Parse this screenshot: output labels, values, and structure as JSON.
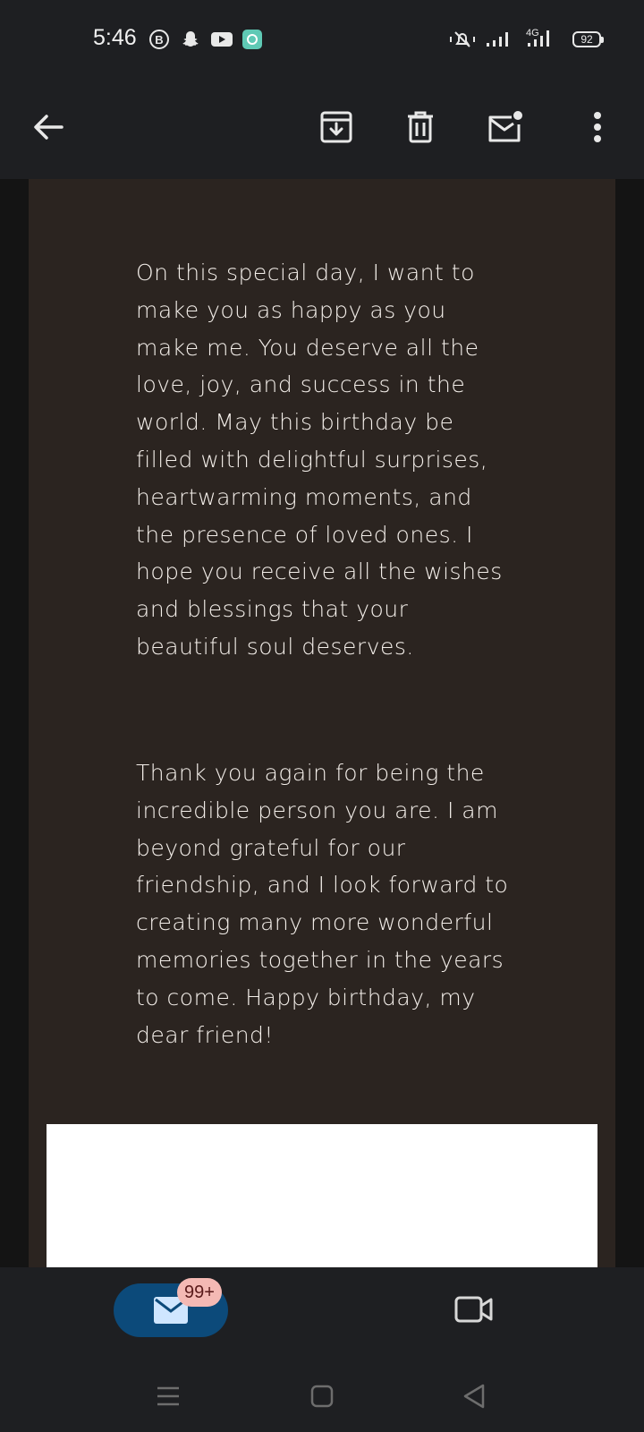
{
  "status_bar": {
    "time": "5:46",
    "battery": "92",
    "network": "4G",
    "icons": [
      "b-circle-icon",
      "snapchat-icon",
      "youtube-icon",
      "app-icon",
      "mute-icon",
      "signal-icon",
      "signal-4g-icon",
      "battery-icon"
    ]
  },
  "toolbar": {
    "icons": [
      "back-arrow-icon",
      "archive-icon",
      "delete-icon",
      "mark-unread-icon",
      "more-options-icon"
    ]
  },
  "email": {
    "paragraph1": "On this special day, I want to make you as happy as you make me. You deserve all the love, joy, and success in the world. May this birthday be filled with delightful surprises, heartwarming moments, and the presence of loved ones. I hope you receive all the wishes and blessings that your beautiful soul deserves.",
    "paragraph2": "Thank you again for being the incredible person you are. I am beyond grateful for our friendship, and I look forward to creating many more wonderful memories together in the years to come. Happy birthday, my dear friend!"
  },
  "bottom_nav": {
    "mail_badge": "99+",
    "icons": [
      "mail-icon",
      "video-camera-icon"
    ]
  },
  "system_nav": {
    "icons": [
      "recents-icon",
      "home-icon",
      "back-triangle-icon"
    ]
  },
  "colors": {
    "background": "#1e1f22",
    "card": "#2b2420",
    "accent": "#0c4a7a",
    "badge": "#f4b9b4"
  }
}
